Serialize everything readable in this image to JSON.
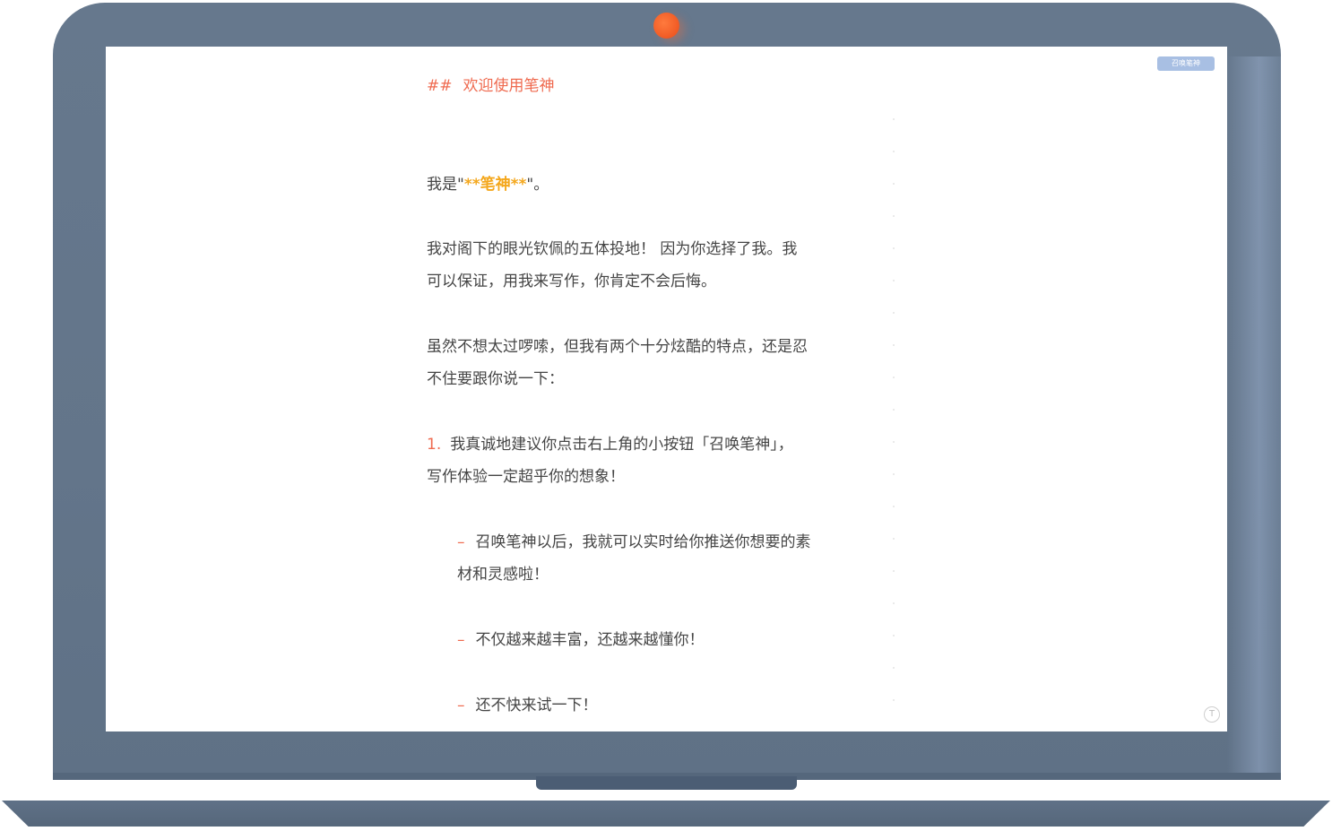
{
  "device": {
    "camera_color": "#f05a24",
    "lid_color": "#64768b"
  },
  "toolbar": {
    "summon_button_label": "召唤笔神"
  },
  "corner_icon": {
    "icon": "text-cursor-icon",
    "glyph": "T"
  },
  "document": {
    "heading_marker": "##",
    "heading_text": "欢迎使用笔神",
    "intro_prefix": "我是\"",
    "intro_bold": "**笔神**",
    "intro_suffix": "\"。",
    "para1_line1": "我对阁下的眼光钦佩的五体投地！  因为你选择了我。我",
    "para1_line2": "可以保证，用我来写作，你肯定不会后悔。",
    "para2_line1": "虽然不想太过啰嗦，但我有两个十分炫酷的特点，还是忍",
    "para2_line2": "不住要跟你说一下：",
    "item1_marker": "1.",
    "item1_line1": "我真诚地建议你点击右上角的小按钮「召唤笔神」，",
    "item1_line2": "写作体验一定超乎你的想象！",
    "bullets": [
      {
        "marker": "–",
        "line1": "召唤笔神以后，我就可以实时给你推送你想要的素",
        "line2": "材和灵感啦！"
      },
      {
        "marker": "–",
        "line1": "不仅越来越丰富，还越来越懂你！",
        "line2": ""
      },
      {
        "marker": "–",
        "line1": "还不快来试一下！",
        "line2": ""
      }
    ]
  },
  "colors": {
    "accent_red": "#ef6a4f",
    "bold_orange": "#f4a71c",
    "button_blue": "#a8bfe3",
    "text": "#454545"
  }
}
